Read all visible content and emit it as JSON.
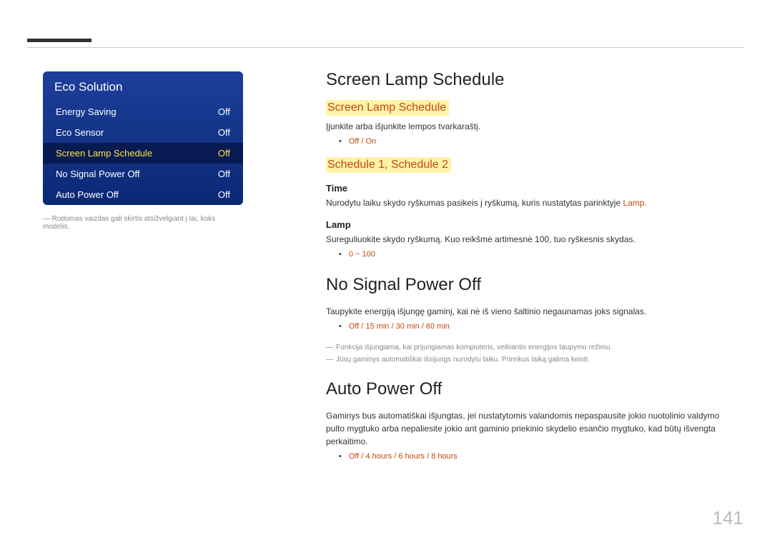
{
  "sidebar": {
    "title": "Eco Solution",
    "items": [
      {
        "label": "Energy Saving",
        "value": "Off"
      },
      {
        "label": "Eco Sensor",
        "value": "Off"
      },
      {
        "label": "Screen Lamp Schedule",
        "value": "Off"
      },
      {
        "label": "No Signal Power Off",
        "value": "Off"
      },
      {
        "label": "Auto Power Off",
        "value": "Off"
      }
    ],
    "note": "― Rodomas vaizdas gali skirtis atsižvelgiant į tai, koks modelis."
  },
  "content": {
    "s1": {
      "title": "Screen Lamp Schedule",
      "h_sls": "Screen Lamp Schedule",
      "sls_desc": "Įjunkite arba išjunkite lempos tvarkaraštį.",
      "sls_opts": "Off / On",
      "h_sched": "Schedule 1, Schedule 2",
      "time_h": "Time",
      "time_desc_a": "Nurodytu laiku skydo ryškumas pasikeis į ryškumą, kuris nustatytas parinktyje ",
      "time_desc_lamp": "Lamp",
      "time_desc_b": ".",
      "lamp_h": "Lamp",
      "lamp_desc": "Sureguliuokite skydo ryškumą. Kuo reikšmė artimesnė 100, tuo ryškesnis skydas.",
      "lamp_range": "0 ~ 100"
    },
    "s2": {
      "title": "No Signal Power Off",
      "desc": "Taupykite energiją išjungę gaminį, kai nė iš vieno šaltinio negaunamas joks signalas.",
      "opts": "Off / 15 min / 30 min / 60 min",
      "note1": "Funkcija išjungiama, kai prijungiamas kompiuteris, veikiantis energijos taupymo režimu.",
      "note2": "Jūsų gaminys automatiškai išsijungs nurodytu laiku. Prireikus laiką galima keisti."
    },
    "s3": {
      "title": "Auto Power Off",
      "desc": "Gaminys bus automatiškai išjungtas, jei nustatytomis valandomis nepaspausite jokio nuotolinio valdymo pulto mygtuko arba nepaliesite jokio ant gaminio priekinio skydelio esančio mygtuko, kad būtų išvengta perkaitimo.",
      "opts": "Off / 4 hours / 6 hours / 8 hours"
    }
  },
  "page": "141"
}
